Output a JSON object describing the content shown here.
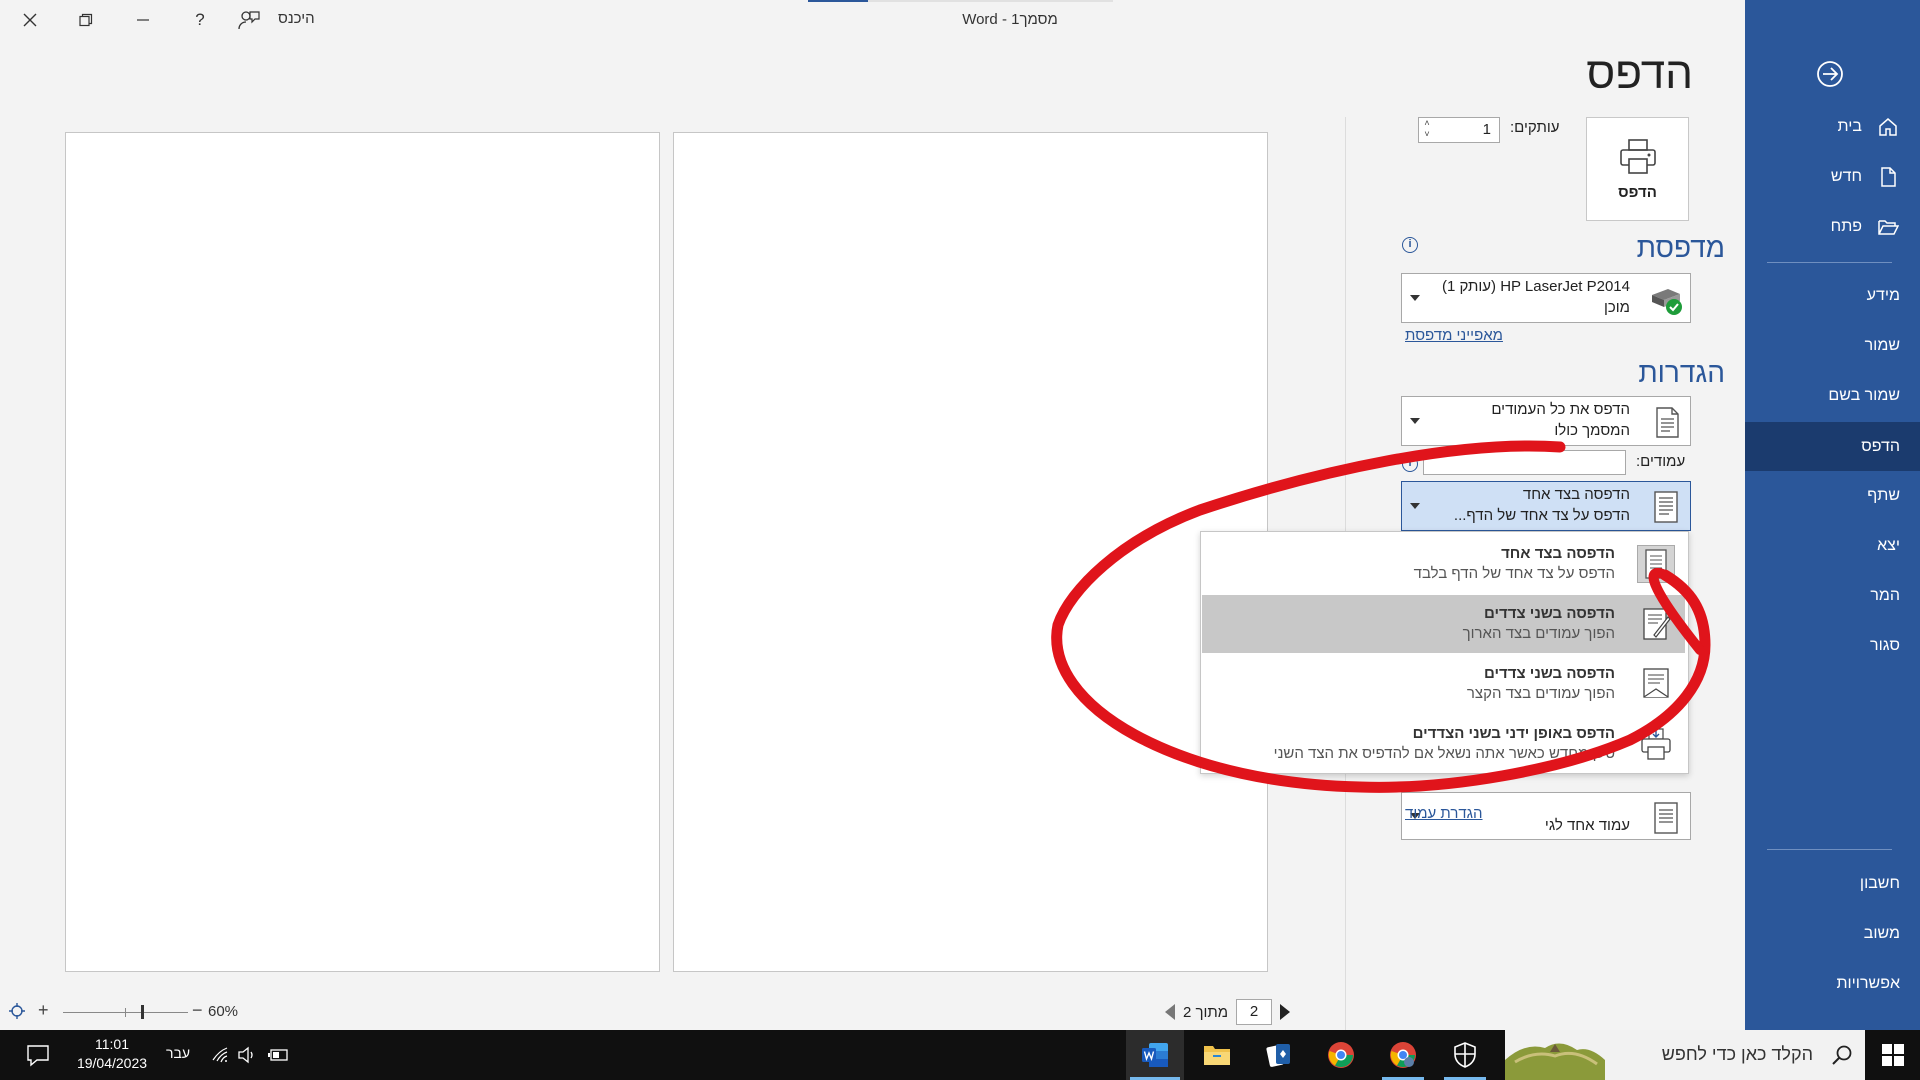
{
  "titlebar": {
    "doc_title": "מסמך1  -  Word",
    "sign_in": "היכנס"
  },
  "nav": {
    "items": [
      {
        "label": "בית",
        "icon": "home-icon"
      },
      {
        "label": "חדש",
        "icon": "new-doc-icon"
      },
      {
        "label": "פתח",
        "icon": "open-folder-icon"
      },
      {
        "label": "מידע"
      },
      {
        "label": "שמור"
      },
      {
        "label": "שמור בשם"
      },
      {
        "label": "הדפס"
      },
      {
        "label": "שתף"
      },
      {
        "label": "יצא"
      },
      {
        "label": "המר"
      },
      {
        "label": "סגור"
      },
      {
        "label": "חשבון"
      },
      {
        "label": "משוב"
      },
      {
        "label": "אפשרויות"
      }
    ],
    "active": "הדפס"
  },
  "print": {
    "title": "הדפס",
    "print_button": "הדפס",
    "copies_label": "עותקים:",
    "copies_value": "1",
    "printer_heading": "מדפסת",
    "printer_name": "HP LaserJet P2014 (עותק 1)",
    "printer_status": "מוכן",
    "printer_properties": "מאפייני מדפסת",
    "settings_heading": "הגדרות",
    "pages_setting": {
      "line1": "הדפס את כל העמודים",
      "line2": "המסמך כולו"
    },
    "pages_label": "עמודים:",
    "pages_value": "",
    "sides_setting": {
      "line1": "הדפסה בצד אחד",
      "line2": "הדפס על צד אחד של הדף..."
    },
    "per_sheet_partial": "עמוד אחד לגי",
    "page_setup_link": "הגדרת עמוד"
  },
  "dropdown": {
    "items": [
      {
        "title": "הדפסה בצד אחד",
        "subtitle": "הדפס על צד אחד של הדף בלבד"
      },
      {
        "title": "הדפסה בשני צדדים",
        "subtitle": "הפוך עמודים בצד הארוך"
      },
      {
        "title": "הדפסה בשני צדדים",
        "subtitle": "הפוך עמודים בצד הקצר"
      },
      {
        "title": "הדפס באופן ידני בשני הצדדים",
        "subtitle": "טען מחדש כאשר אתה נשאל אם להדפיס את הצד השני"
      }
    ],
    "highlighted_index": 1
  },
  "preview": {
    "current_page": "2",
    "of_text": "מתוך 2",
    "zoom": "60%"
  },
  "taskbar": {
    "search_placeholder": "הקלד כאן כדי לחפש",
    "time": "11:01",
    "date": "19/04/2023",
    "language": "עבר"
  },
  "colors": {
    "word_blue": "#2b579a",
    "nav_active": "#1b3b6e",
    "annotation_red": "#e0141b"
  }
}
